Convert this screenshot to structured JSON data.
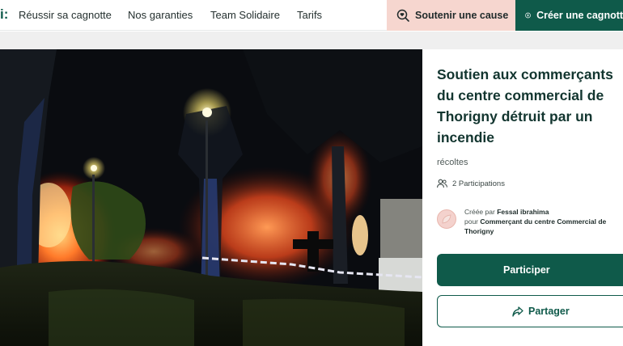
{
  "nav": {
    "brand_fragment": "i:",
    "links": [
      "Réussir sa cagnotte",
      "Nos garanties",
      "Team Solidaire",
      "Tarifs"
    ],
    "support_button": "Soutenir une cause",
    "create_button": "Créer une cagnotte"
  },
  "campaign": {
    "title": "Soutien aux commerçants\ndu centre commercial de\nThorigny détruit par un\nincendie",
    "collected_label": "récoltes",
    "participations": "2 Participations",
    "created_by_prefix": "Créée par",
    "creator_name": "Fessal ibrahima",
    "for_prefix": "pour",
    "beneficiary": "Commerçant du centre Commercial de Thorigny",
    "participate_button": "Participer",
    "share_button": "Partager"
  },
  "colors": {
    "brand_green": "#0f5a4a",
    "support_pink": "#f6d6cf",
    "title_color": "#12352f"
  },
  "icons": [
    "search-heart-icon",
    "plus-circle-icon",
    "people-icon",
    "share-icon"
  ]
}
